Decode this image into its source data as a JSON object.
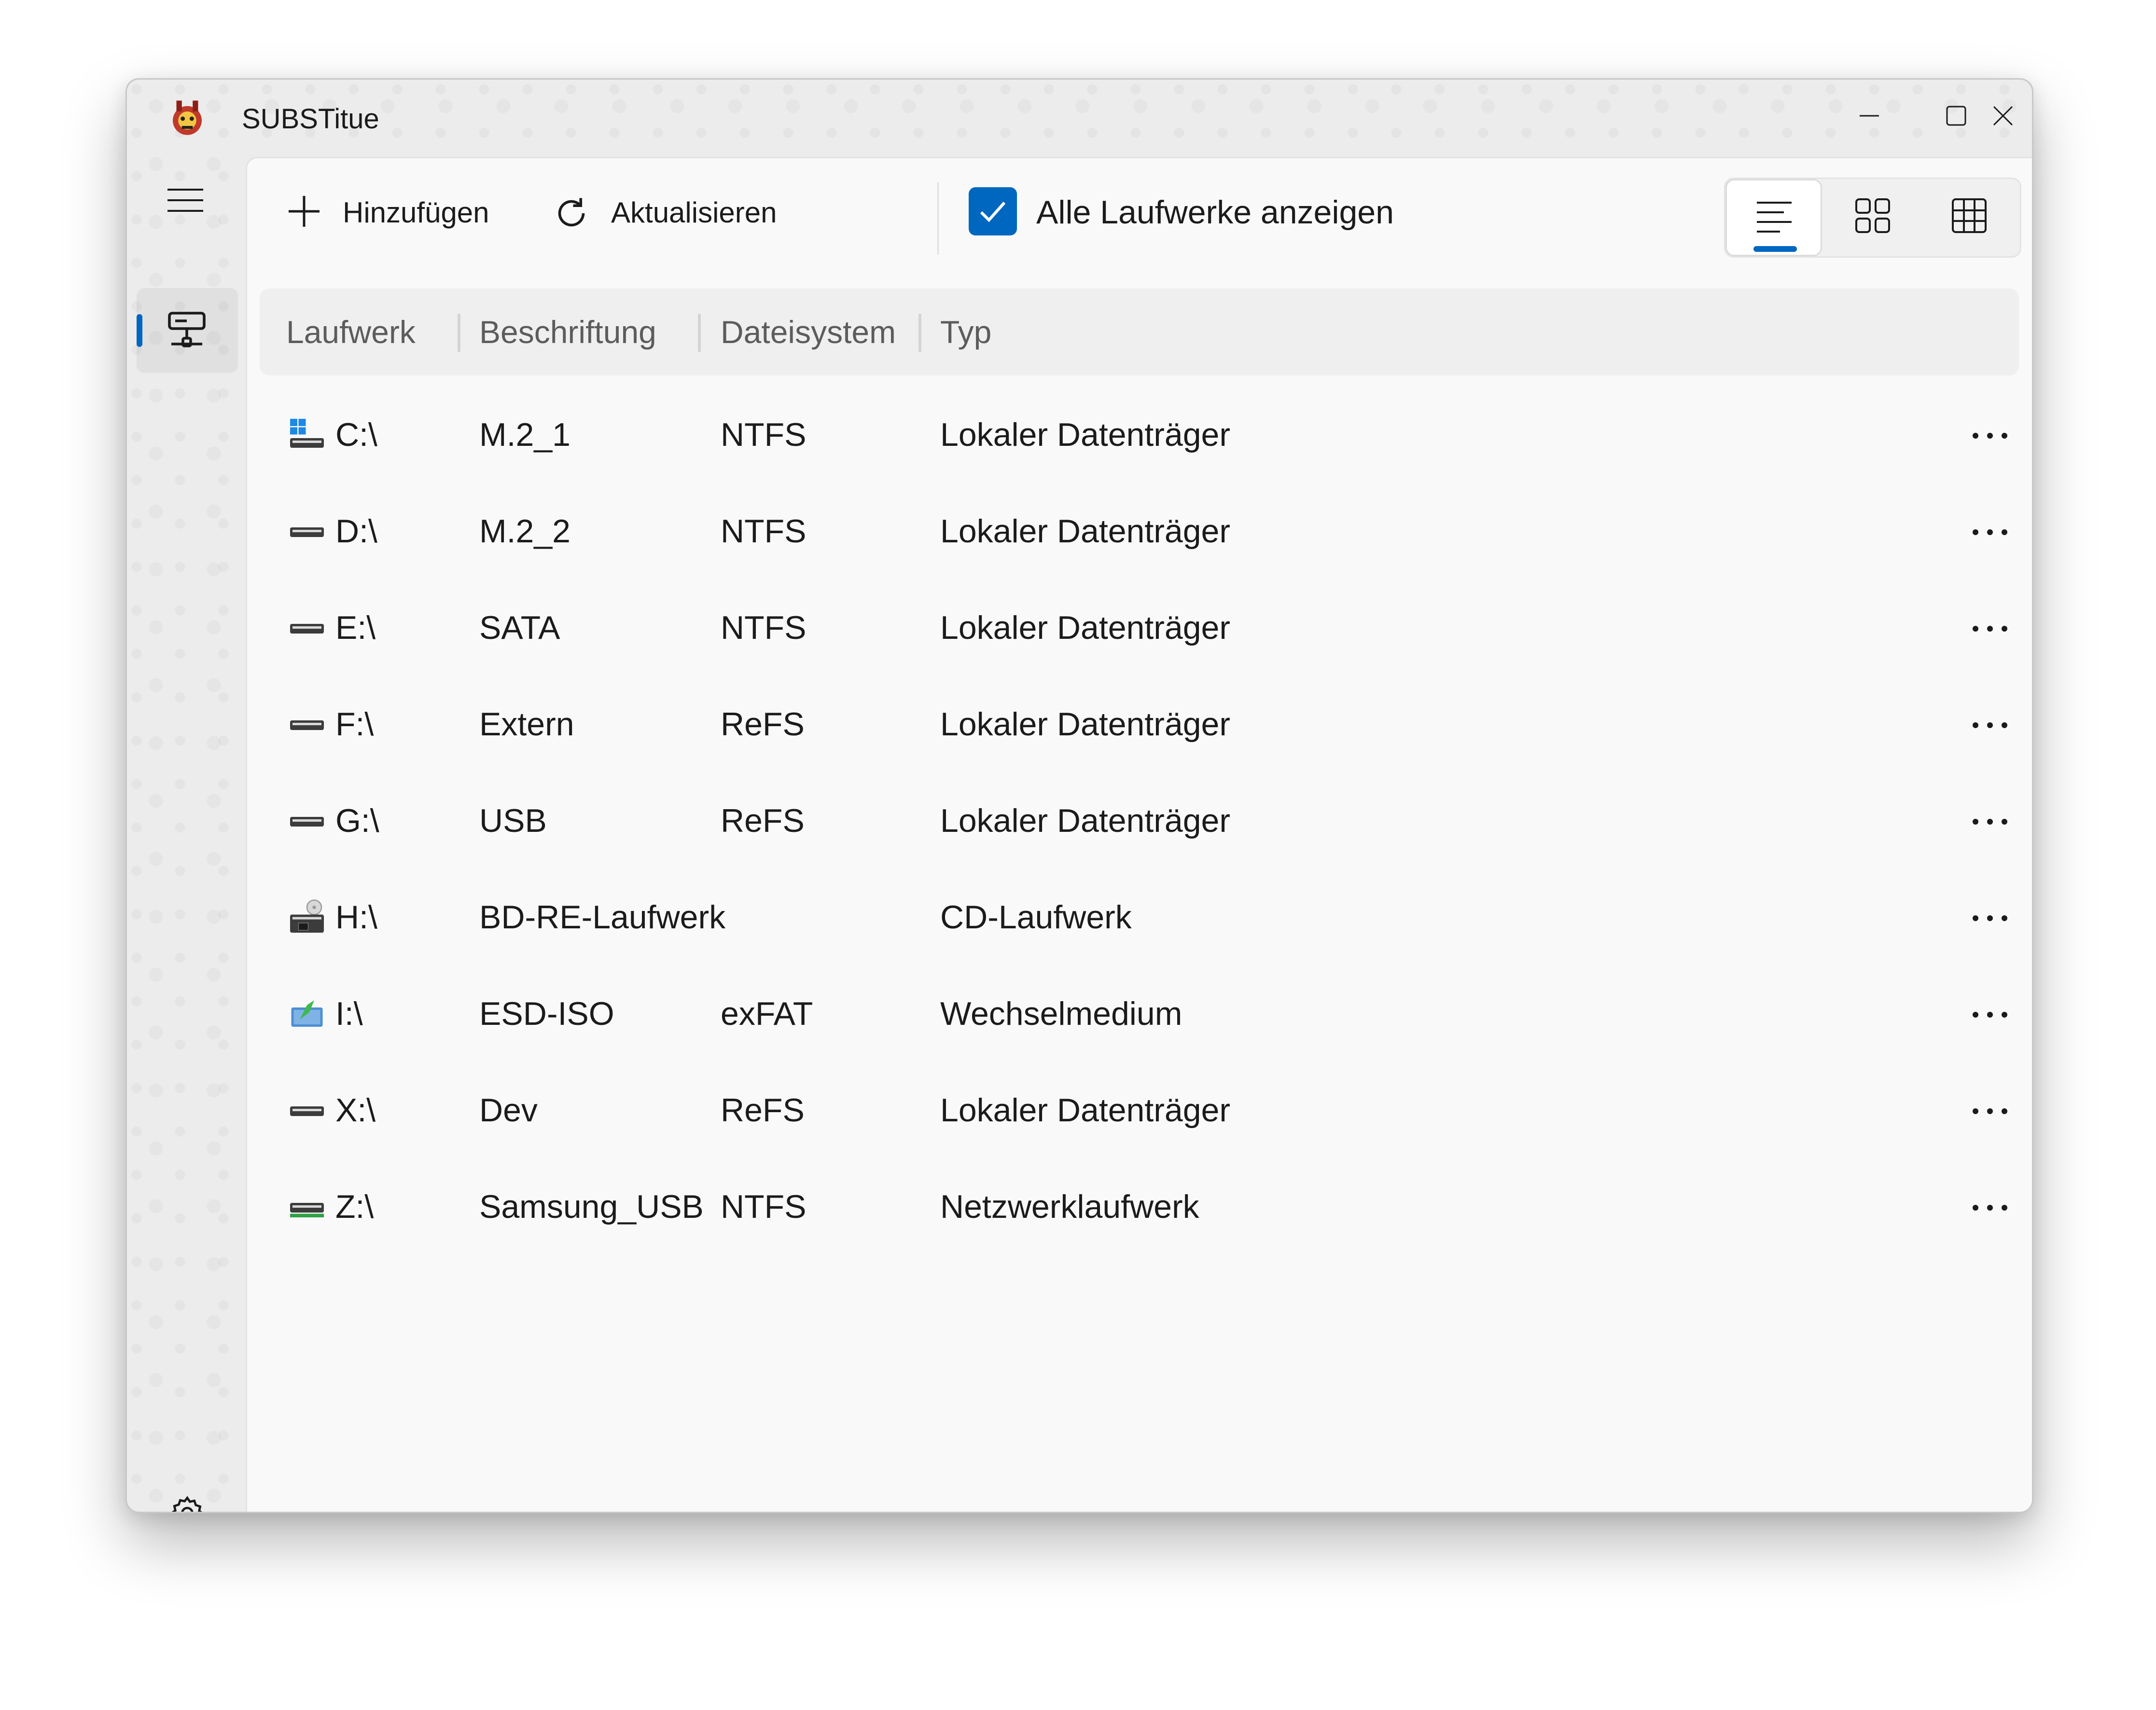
{
  "window": {
    "title": "SUBSTitue"
  },
  "toolbar": {
    "add_label": "Hinzufügen",
    "refresh_label": "Aktualisieren",
    "show_all_label": "Alle Laufwerke anzeigen",
    "show_all_checked": true
  },
  "view_modes": [
    {
      "icon": "list-view-icon",
      "selected": true
    },
    {
      "icon": "tiles-view-icon",
      "selected": false
    },
    {
      "icon": "table-view-icon",
      "selected": false
    }
  ],
  "columns": {
    "drive": "Laufwerk",
    "label": "Beschriftung",
    "filesystem": "Dateisystem",
    "type": "Typ"
  },
  "drives": [
    {
      "drive": "C:\\",
      "label": "M.2_1",
      "filesystem": "NTFS",
      "type": "Lokaler Datenträger",
      "icon": "windows-drive-icon"
    },
    {
      "drive": "D:\\",
      "label": "M.2_2",
      "filesystem": "NTFS",
      "type": "Lokaler Datenträger",
      "icon": "hard-drive-icon"
    },
    {
      "drive": "E:\\",
      "label": "SATA",
      "filesystem": "NTFS",
      "type": "Lokaler Datenträger",
      "icon": "hard-drive-icon"
    },
    {
      "drive": "F:\\",
      "label": "Extern",
      "filesystem": "ReFS",
      "type": "Lokaler Datenträger",
      "icon": "hard-drive-icon"
    },
    {
      "drive": "G:\\",
      "label": "USB",
      "filesystem": "ReFS",
      "type": "Lokaler Datenträger",
      "icon": "hard-drive-icon"
    },
    {
      "drive": "H:\\",
      "label": "BD-RE-Laufwerk",
      "filesystem": "",
      "type": "CD-Laufwerk",
      "icon": "optical-drive-icon"
    },
    {
      "drive": "I:\\",
      "label": "ESD-ISO",
      "filesystem": "exFAT",
      "type": "Wechselmedium",
      "icon": "removable-media-icon"
    },
    {
      "drive": "X:\\",
      "label": "Dev",
      "filesystem": "ReFS",
      "type": "Lokaler Datenträger",
      "icon": "hard-drive-icon"
    },
    {
      "drive": "Z:\\",
      "label": "Samsung_USB",
      "filesystem": "NTFS",
      "type": "Netzwerklaufwerk",
      "icon": "network-drive-icon"
    }
  ],
  "colors": {
    "accent": "#0067c0",
    "content_bg": "#f9f9f9",
    "header_bg": "#efefef"
  }
}
